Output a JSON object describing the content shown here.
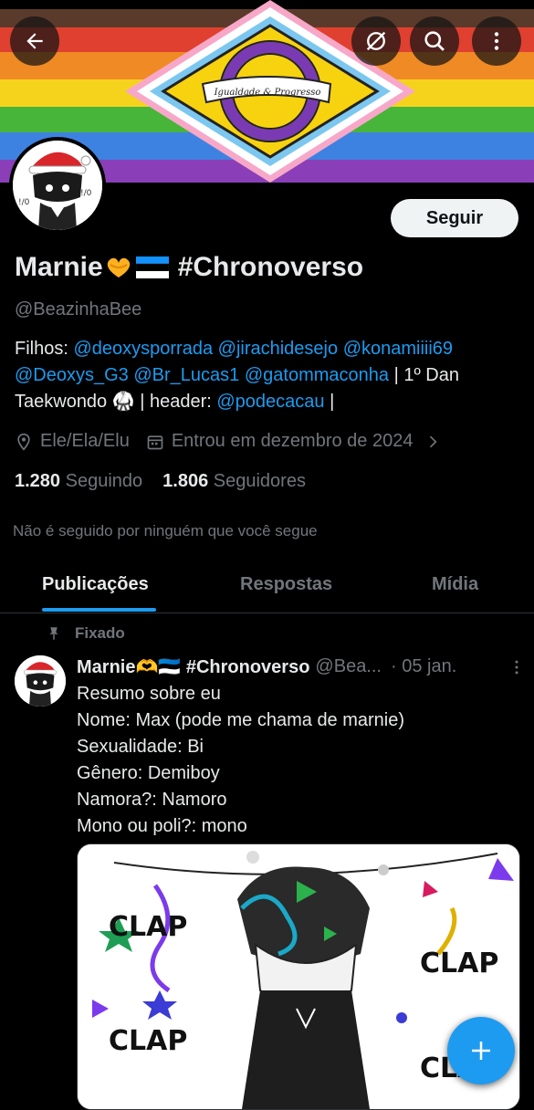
{
  "profile": {
    "name": "Marnie🫶🇪🇪 #Chronoverso",
    "name_text": "Marnie",
    "name_suffix": "#Chronoverso",
    "handle": "@BeazinhaBee",
    "follow_label": "Seguir",
    "banner_ribbon_text": "Igualdade & Progresso",
    "bio": {
      "prefix": "Filhos: ",
      "links": [
        "@deoxysporrada",
        "@jirachidesejo",
        "@konamiiii69",
        "@Deoxys_G3",
        "@Br_Lucas1",
        "@gatommaconha"
      ],
      "middle": " | 1º Dan Taekwondo 🥋 | header: ",
      "header_link": "@podecacau",
      "suffix": " |"
    },
    "pronouns": "Ele/Ela/Elu",
    "joined": "Entrou em dezembro de 2024",
    "following_count": "1.280",
    "following_label": "Seguindo",
    "followers_count": "1.806",
    "followers_label": "Seguidores",
    "not_followed_text": "Não é seguido por ninguém que você segue"
  },
  "tabs": [
    {
      "label": "Publicações",
      "active": true
    },
    {
      "label": "Respostas",
      "active": false
    },
    {
      "label": "Mídia",
      "active": false
    }
  ],
  "pinned_post": {
    "pinned_label": "Fixado",
    "author_name": "Marnie🫶🇪🇪 #Chronoverso",
    "author_handle": "@Bea...",
    "date": "· 05 jan.",
    "lines": [
      "Resumo sobre eu",
      "Nome: Max (pode me chama de marnie)",
      "Sexualidade: Bi",
      "Gênero: Demiboy",
      "Namora?: Namoro",
      "Mono ou poli?: mono"
    ],
    "media_text": [
      "CLAP",
      "CLAP",
      "CLAP",
      "CLAP"
    ]
  },
  "colors": {
    "accent": "#1d9bf0",
    "background": "#000000",
    "muted": "#71767b",
    "text": "#e7e9ea"
  },
  "icons": {
    "back": "arrow-left-icon",
    "mute": "circle-slash-icon",
    "search": "search-icon",
    "more": "more-vertical-icon",
    "location": "location-pin-icon",
    "calendar": "calendar-icon",
    "chevron": "chevron-right-icon",
    "pin": "pin-icon",
    "compose": "plus-icon"
  }
}
